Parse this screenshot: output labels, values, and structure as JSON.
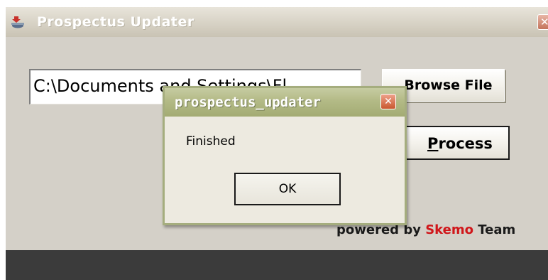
{
  "main_window": {
    "title": "Prospectus Updater",
    "close_glyph": "✕",
    "file_path_value": "C:\\Documents and Settings\\Fl",
    "browse_button_label": "Browse File",
    "process_button": {
      "mnemonic": "P",
      "rest": "rocess"
    },
    "credit": {
      "prefix": "powered  by ",
      "brand": "Skemo",
      "suffix": " Team"
    }
  },
  "dialog": {
    "title": "prospectus_updater",
    "close_glyph": "✕",
    "message": "Finished",
    "ok_label": "OK"
  },
  "colors": {
    "dialog_title_bar": "#b3ba86",
    "brand_red": "#d0161a",
    "window_face": "#d4d0c8"
  },
  "icons": [
    "app-icon",
    "close-icon"
  ]
}
